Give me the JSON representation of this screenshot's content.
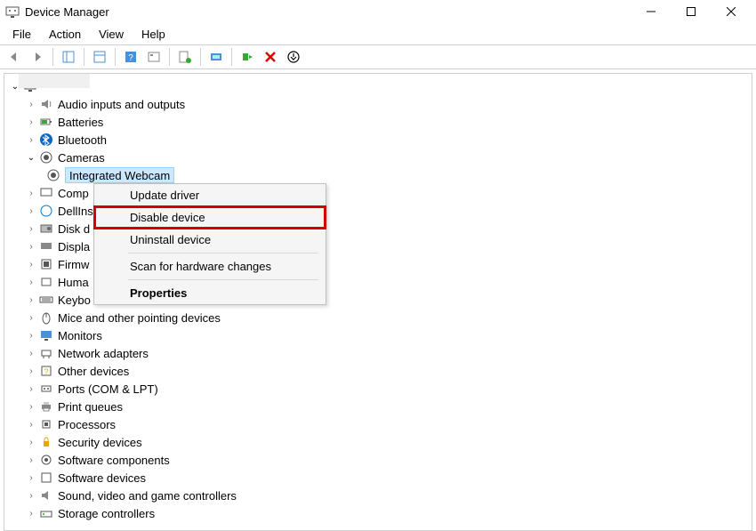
{
  "title": "Device Manager",
  "menubar": [
    "File",
    "Action",
    "View",
    "Help"
  ],
  "tree": {
    "selected_child": "Integrated Webcam",
    "categories": [
      {
        "label": "Audio inputs and outputs",
        "expanded": false,
        "icon": "audio"
      },
      {
        "label": "Batteries",
        "expanded": false,
        "icon": "battery"
      },
      {
        "label": "Bluetooth",
        "expanded": false,
        "icon": "bluetooth"
      },
      {
        "label": "Cameras",
        "expanded": true,
        "icon": "camera"
      },
      {
        "label": "Comp",
        "truncated": true,
        "icon": "computer"
      },
      {
        "label": "DellIns",
        "truncated": true,
        "icon": "dell"
      },
      {
        "label": "Disk d",
        "truncated": true,
        "icon": "disk"
      },
      {
        "label": "Displa",
        "truncated": true,
        "icon": "display"
      },
      {
        "label": "Firmw",
        "truncated": true,
        "icon": "firmware"
      },
      {
        "label": "Huma",
        "truncated": true,
        "icon": "hid"
      },
      {
        "label": "Keybo",
        "truncated": true,
        "icon": "keyboard"
      },
      {
        "label": "Mice and other pointing devices",
        "icon": "mouse"
      },
      {
        "label": "Monitors",
        "icon": "monitor"
      },
      {
        "label": "Network adapters",
        "icon": "network"
      },
      {
        "label": "Other devices",
        "icon": "other"
      },
      {
        "label": "Ports (COM & LPT)",
        "icon": "port"
      },
      {
        "label": "Print queues",
        "icon": "printer"
      },
      {
        "label": "Processors",
        "icon": "cpu"
      },
      {
        "label": "Security devices",
        "icon": "security"
      },
      {
        "label": "Software components",
        "icon": "software"
      },
      {
        "label": "Software devices",
        "icon": "software"
      },
      {
        "label": "Sound, video and game controllers",
        "icon": "sound"
      },
      {
        "label": "Storage controllers",
        "icon": "storage"
      }
    ]
  },
  "context_menu": {
    "items": [
      {
        "label": "Update driver",
        "highlight": false
      },
      {
        "label": "Disable device",
        "highlight": true
      },
      {
        "label": "Uninstall device",
        "highlight": false
      },
      {
        "sep": true
      },
      {
        "label": "Scan for hardware changes",
        "highlight": false
      },
      {
        "sep": true
      },
      {
        "label": "Properties",
        "bold": true
      }
    ]
  }
}
